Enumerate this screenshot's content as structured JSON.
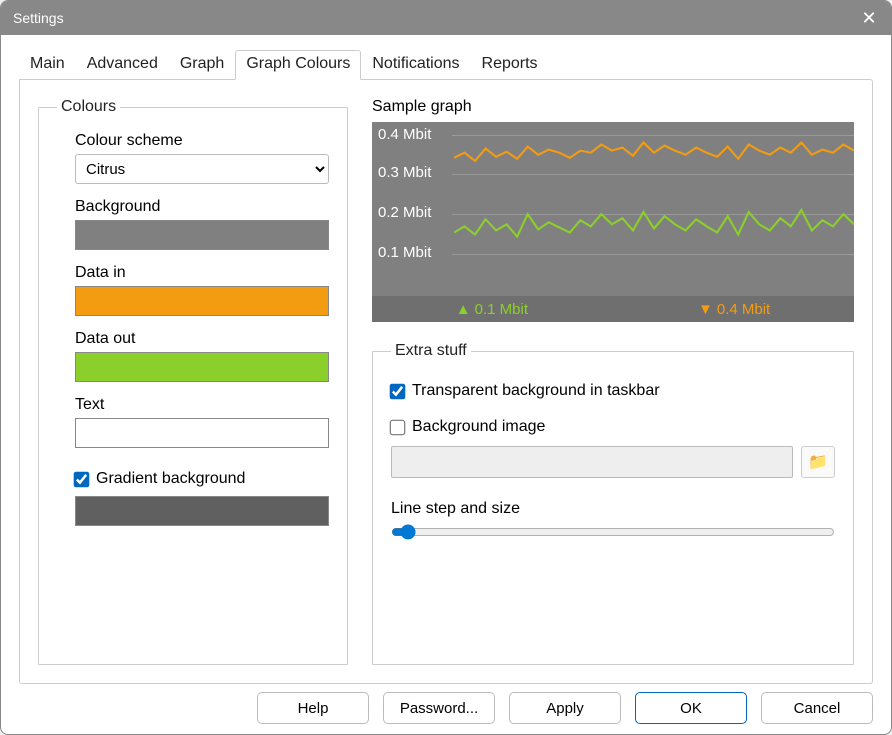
{
  "window": {
    "title": "Settings"
  },
  "tabs": [
    "Main",
    "Advanced",
    "Graph",
    "Graph Colours",
    "Notifications",
    "Reports"
  ],
  "active_tab": 3,
  "colours": {
    "legend": "Colours",
    "scheme_label": "Colour scheme",
    "scheme_value": "Citrus",
    "background_label": "Background",
    "background_colour": "#808080",
    "data_in_label": "Data in",
    "data_in_colour": "#f39c12",
    "data_out_label": "Data out",
    "data_out_colour": "#8bd02a",
    "text_label": "Text",
    "text_colour": "#ffffff",
    "gradient_label": "Gradient background",
    "gradient_checked": true,
    "gradient_colour": "#606060"
  },
  "sample": {
    "header": "Sample graph",
    "y_ticks": [
      "0.4 Mbit",
      "0.3 Mbit",
      "0.2 Mbit",
      "0.1 Mbit"
    ],
    "footer_in_value": "0.1 Mbit",
    "footer_out_value": "0.4 Mbit"
  },
  "extra": {
    "legend": "Extra stuff",
    "transparent_label": "Transparent background in taskbar",
    "transparent_checked": true,
    "bgimage_label": "Background image",
    "bgimage_checked": false,
    "bgimage_path": "",
    "slider_label": "Line step and size",
    "slider_value": 2,
    "slider_min": 0,
    "slider_max": 100
  },
  "buttons": {
    "help": "Help",
    "password": "Password...",
    "apply": "Apply",
    "ok": "OK",
    "cancel": "Cancel"
  },
  "chart_data": {
    "type": "line",
    "x_range": [
      0,
      100
    ],
    "ylim": [
      0,
      0.45
    ],
    "y_ticks": [
      0.1,
      0.2,
      0.3,
      0.4
    ],
    "series": [
      {
        "name": "Data in",
        "colour": "#f39c12",
        "mean": 0.35,
        "range": [
          0.3,
          0.41
        ]
      },
      {
        "name": "Data out",
        "colour": "#8bd02a",
        "mean": 0.12,
        "range": [
          0.08,
          0.18
        ]
      }
    ],
    "footer": {
      "in": 0.1,
      "out": 0.4,
      "units": "Mbit"
    }
  }
}
